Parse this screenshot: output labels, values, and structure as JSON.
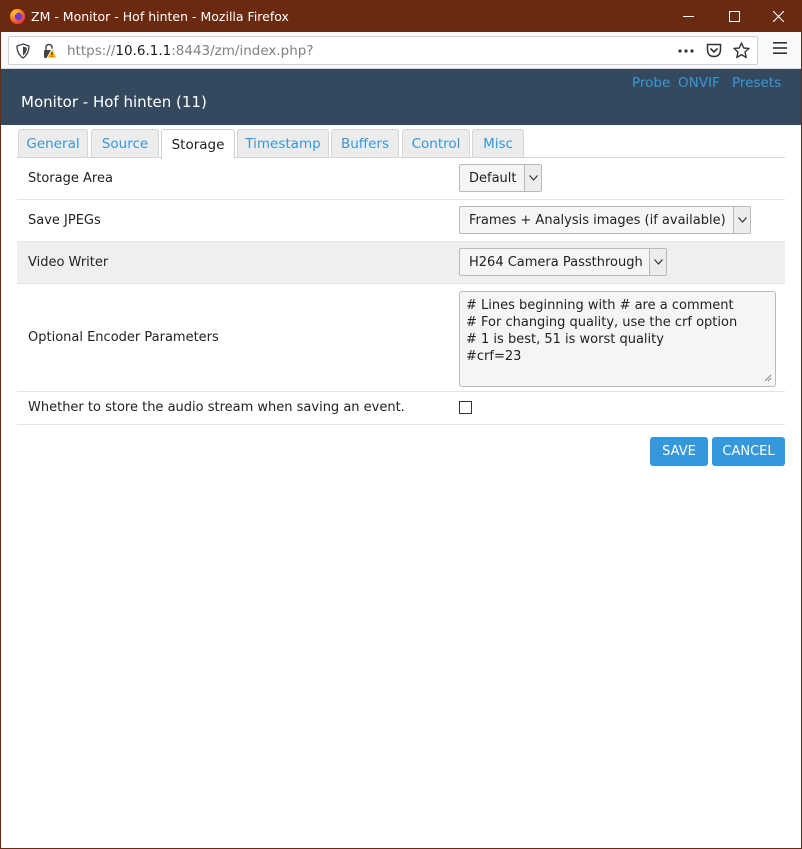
{
  "window": {
    "title": "ZM - Monitor - Hof hinten - Mozilla Firefox"
  },
  "browser": {
    "url_prefix": "https://",
    "url_host": "10.6.1.1",
    "url_rest": ":8443/zm/index.php?"
  },
  "header": {
    "title": "Monitor - Hof hinten (11)",
    "links": [
      "Probe",
      "ONVIF",
      "Presets"
    ]
  },
  "tabs": [
    {
      "label": "General",
      "active": false
    },
    {
      "label": "Source",
      "active": false
    },
    {
      "label": "Storage",
      "active": true
    },
    {
      "label": "Timestamp",
      "active": false
    },
    {
      "label": "Buffers",
      "active": false
    },
    {
      "label": "Control",
      "active": false
    },
    {
      "label": "Misc",
      "active": false
    }
  ],
  "form": {
    "storage_area": {
      "label": "Storage Area",
      "value": "Default"
    },
    "save_jpegs": {
      "label": "Save JPEGs",
      "value": "Frames + Analysis images (if available)"
    },
    "video_writer": {
      "label": "Video Writer",
      "value": "H264 Camera Passthrough"
    },
    "encoder_params": {
      "label": "Optional Encoder Parameters",
      "value": "# Lines beginning with # are a comment\n# For changing quality, use the crf option\n# 1 is best, 51 is worst quality\n#crf=23"
    },
    "store_audio": {
      "label": "Whether to store the audio stream when saving an event.",
      "checked": false
    }
  },
  "buttons": {
    "save": "SAVE",
    "cancel": "CANCEL"
  },
  "colors": {
    "titlebar": "#6b2a10",
    "header": "#34495e",
    "link": "#3498db",
    "button": "#3498db"
  },
  "icons": [
    "firefox-icon",
    "minimize-icon",
    "maximize-icon",
    "close-icon",
    "tracking-shield-icon",
    "insecure-lock-icon",
    "more-actions-icon",
    "pocket-icon",
    "bookmark-star-icon",
    "hamburger-menu-icon",
    "chevron-down-icon",
    "resize-grip-icon"
  ]
}
